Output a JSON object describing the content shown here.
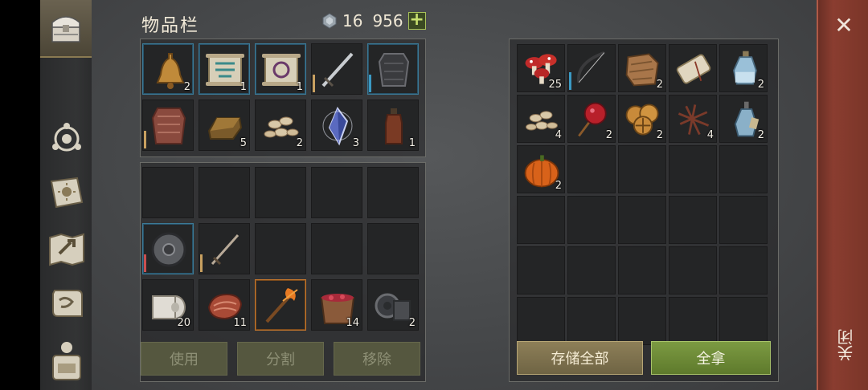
{
  "inventory": {
    "title": "物品栏",
    "currency_amount": "16",
    "currency_amount2": "956",
    "add_label": "+"
  },
  "left_grid": [
    {
      "name": "bell",
      "count": "2",
      "hl": true
    },
    {
      "name": "scroll-blue",
      "count": "1",
      "hl": true
    },
    {
      "name": "scroll-purple",
      "count": "1",
      "hl": true
    },
    {
      "name": "sword",
      "count": "",
      "hl": false,
      "bar": "#c8a060"
    },
    {
      "name": "armor",
      "count": "",
      "hl": true,
      "bar": "#3b9ac4"
    },
    {
      "name": "chainmail",
      "count": "",
      "hl": false,
      "bar": "#c8a060"
    },
    {
      "name": "ingot",
      "count": "5",
      "hl": false
    },
    {
      "name": "seeds",
      "count": "2",
      "hl": false
    },
    {
      "name": "crystal",
      "count": "3",
      "hl": false
    },
    {
      "name": "bottle",
      "count": "1",
      "hl": false
    }
  ],
  "equip_grid": [
    {
      "name": "empty"
    },
    {
      "name": "empty"
    },
    {
      "name": "empty"
    },
    {
      "name": "empty"
    },
    {
      "name": "empty"
    },
    {
      "name": "shield",
      "count": "",
      "hl": true,
      "bar": "#c85050"
    },
    {
      "name": "shortsword",
      "count": "",
      "hl": false,
      "bar": "#c8a060"
    },
    {
      "name": "empty"
    },
    {
      "name": "empty"
    },
    {
      "name": "empty"
    },
    {
      "name": "cloth-roll",
      "count": "20"
    },
    {
      "name": "meat",
      "count": "11"
    },
    {
      "name": "torch",
      "count": "",
      "orange": true
    },
    {
      "name": "berry-bucket",
      "count": "14"
    },
    {
      "name": "gear",
      "count": "2"
    }
  ],
  "buttons": {
    "use": "使用",
    "split": "分割",
    "remove": "移除",
    "store_all": "存储全部",
    "take_all": "全拿"
  },
  "right_grid": [
    {
      "name": "mushroom",
      "count": "25"
    },
    {
      "name": "bow",
      "count": "",
      "bar": "#3b9ac4"
    },
    {
      "name": "leather",
      "count": "2"
    },
    {
      "name": "rolled-paper",
      "count": ""
    },
    {
      "name": "potion",
      "count": "2"
    },
    {
      "name": "seeds",
      "count": "4"
    },
    {
      "name": "candy-apple",
      "count": "2"
    },
    {
      "name": "cookies",
      "count": "2"
    },
    {
      "name": "twigs",
      "count": "4"
    },
    {
      "name": "potion2",
      "count": "2"
    },
    {
      "name": "pumpkin",
      "count": "2"
    }
  ],
  "close_label": "关闭",
  "tabs": [
    "chest-icon",
    "compass-icon",
    "book-icon",
    "map-icon",
    "scroll-icon",
    "backpack-icon"
  ]
}
